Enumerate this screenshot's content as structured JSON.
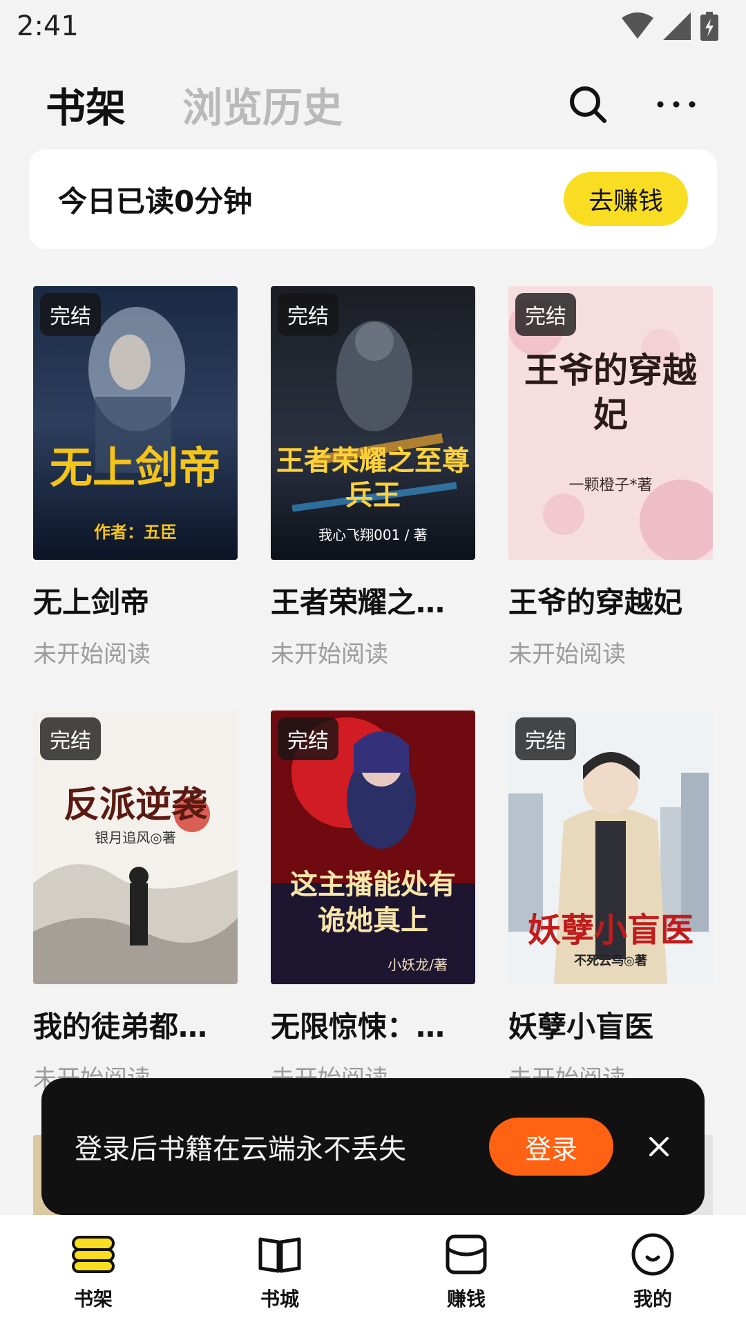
{
  "status_bar": {
    "time": "2:41",
    "icons": [
      "wifi-icon",
      "signal-icon",
      "battery-charging-icon"
    ]
  },
  "header": {
    "tabs": [
      {
        "label": "书架",
        "active": true
      },
      {
        "label": "浏览历史",
        "active": false
      }
    ],
    "actions": [
      "search-icon",
      "more-icon"
    ]
  },
  "reading_card": {
    "text": "今日已读0分钟",
    "button_label": "去赚钱",
    "button_color": "#f9dd22"
  },
  "books": [
    {
      "title": "无上剑帝",
      "status": "未开始阅读",
      "badge": "完结",
      "cover_text": "无上剑帝",
      "cover_author": "作者：五臣"
    },
    {
      "title": "王者荣耀之…",
      "status": "未开始阅读",
      "badge": "完结",
      "cover_text": "王者荣耀之至尊兵王",
      "cover_author": "我心飞翔001 / 著"
    },
    {
      "title": "王爷的穿越妃",
      "status": "未开始阅读",
      "badge": "完结",
      "cover_text": "王爷的穿越妃",
      "cover_author": "一颗橙子*著"
    },
    {
      "title": "我的徒弟都…",
      "status": "未开始阅读",
      "badge": "完结",
      "cover_text": "反派逆袭",
      "cover_author": "银月追风◎著"
    },
    {
      "title": "无限惊悚：…",
      "status": "未开始阅读",
      "badge": "完结",
      "cover_text": "这主播能处有诡她真上",
      "cover_author": "小妖龙/著"
    },
    {
      "title": "妖孽小盲医",
      "status": "未开始阅读",
      "badge": "完结",
      "cover_text": "妖孽小盲医",
      "cover_author": "不死云鸟◎著"
    }
  ],
  "login_toast": {
    "text": "登录后书籍在云端永不丢失",
    "button_label": "登录",
    "button_color": "#ff6212"
  },
  "bottom_nav": [
    {
      "label": "书架",
      "icon": "bookshelf-icon",
      "active": true
    },
    {
      "label": "书城",
      "icon": "book-open-icon",
      "active": false
    },
    {
      "label": "赚钱",
      "icon": "envelope-icon",
      "active": false
    },
    {
      "label": "我的",
      "icon": "smile-icon",
      "active": false
    }
  ]
}
